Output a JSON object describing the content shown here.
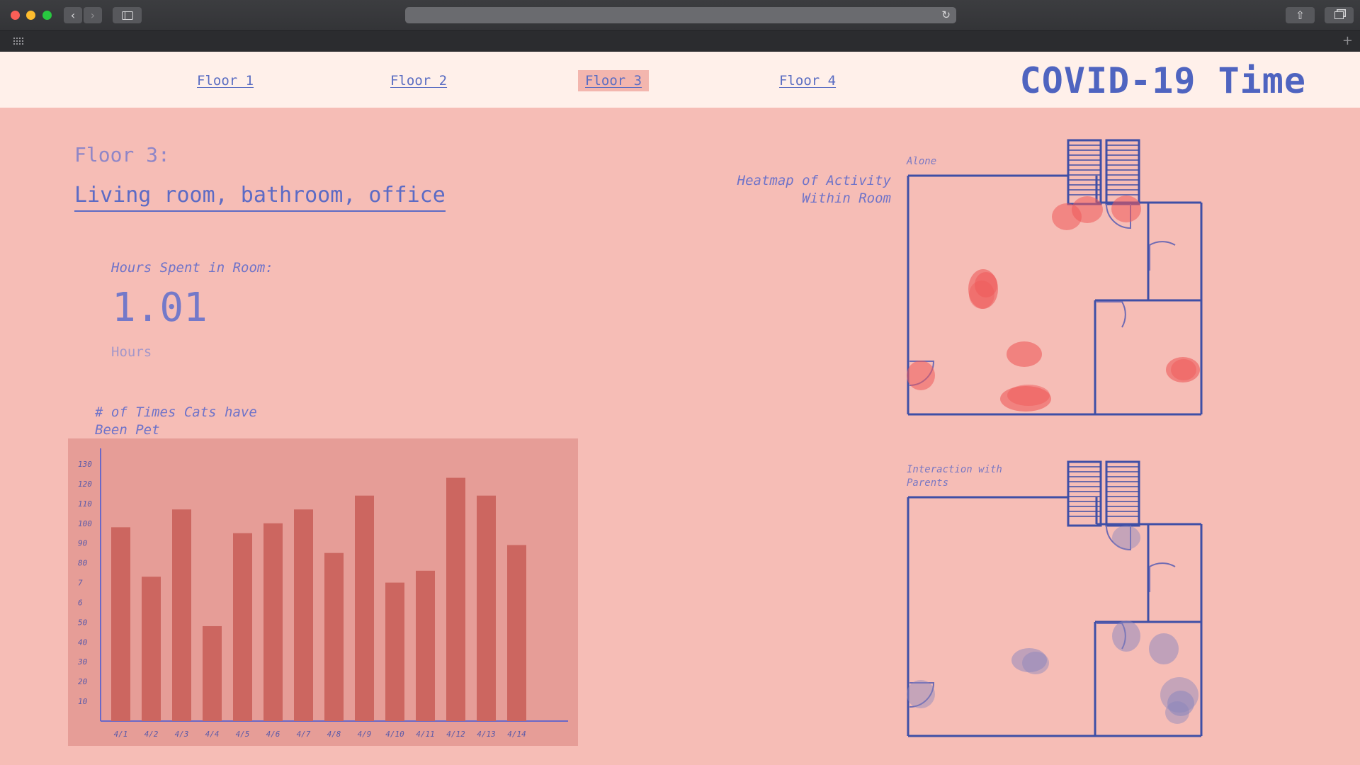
{
  "nav": {
    "links": [
      "Floor 1",
      "Floor 2",
      "Floor 3",
      "Floor 4"
    ],
    "active_index": 2,
    "site_title": "COVID-19 Time"
  },
  "page": {
    "floor_label": "Floor 3:",
    "rooms": "Living room, bathroom, office",
    "hours_label": "Hours Spent in Room:",
    "hours_value": "1.01",
    "hours_unit": "Hours"
  },
  "heatmaps": {
    "heading": "Heatmap of Activity Within Room",
    "alone_label": "Alone",
    "parents_label": "Interaction with Parents"
  },
  "colors": {
    "background": "#f6bdb6",
    "nav_background": "#fff0ea",
    "accent": "#4f64c0",
    "bar": "#cc6660",
    "chart_background": "#e69d97",
    "heat_alone": "#ef5a5a",
    "heat_parents": "#8a86bd"
  },
  "chart_data": {
    "type": "bar",
    "title": "# of Times Cats have Been Pet",
    "categories": [
      "4/1",
      "4/2",
      "4/3",
      "4/4",
      "4/5",
      "4/6",
      "4/7",
      "4/8",
      "4/9",
      "4/10",
      "4/11",
      "4/12",
      "4/13",
      "4/14"
    ],
    "values": [
      98,
      73,
      107,
      48,
      95,
      100,
      107,
      85,
      114,
      70,
      76,
      123,
      114,
      89
    ],
    "y_tick_labels": [
      "10",
      "20",
      "30",
      "40",
      "50",
      "6",
      "7",
      "80",
      "90",
      "100",
      "110",
      "120",
      "130"
    ],
    "ylim": [
      0,
      140
    ],
    "xlabel": "",
    "ylabel": "",
    "grid": false
  }
}
